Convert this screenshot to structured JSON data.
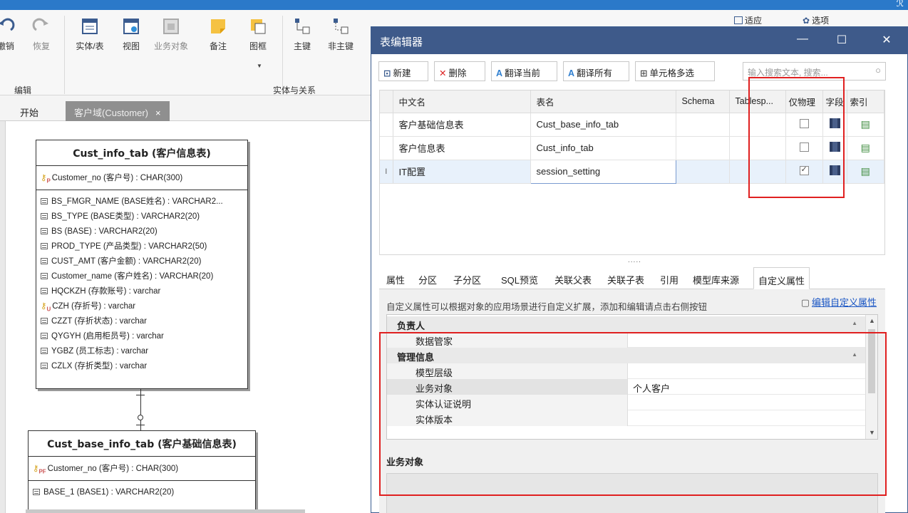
{
  "app": {
    "user_icon": "user-icon"
  },
  "ribbon": {
    "undo": "撤销",
    "redo": "恢复",
    "entity_table": "实体/表",
    "view": "视图",
    "business_object": "业务对象",
    "note": "备注",
    "frame": "图框",
    "primary_key": "主键",
    "non_primary_key": "非主键",
    "fit": "适应",
    "options": "选项",
    "group_edit": "编辑",
    "group_entity_relation": "实体与关系"
  },
  "doc_tabs": {
    "start": "开始",
    "customer": "客户域(Customer)",
    "close": "×"
  },
  "entities": {
    "cust_info": {
      "title": "Cust_info_tab (客户信息表)",
      "pk_mark": "P",
      "pk": "Customer_no (客户号) : CHAR(300)",
      "columns": [
        "BS_FMGR_NAME (BASE姓名) : VARCHAR2...",
        "BS_TYPE (BASE类型) : VARCHAR2(20)",
        "BS (BASE) : VARCHAR2(20)",
        "PROD_TYPE (产品类型) : VARCHAR2(50)",
        "CUST_AMT (客户金额) : VARCHAR2(20)",
        "Customer_name (客户姓名) : VARCHAR(20)",
        "HQCKZH (存款账号) : varchar",
        "CZH (存折号) : varchar",
        "CZZT (存折状态) : varchar",
        "QYGYH (启用柜员号) : varchar",
        "YGBZ (员工标志) : varchar",
        "CZLX (存折类型) : varchar"
      ],
      "unique_mark": "U"
    },
    "cust_base": {
      "title": "Cust_base_info_tab (客户基础信息表)",
      "pk_mark": "PF",
      "pk": "Customer_no (客户号) : CHAR(300)",
      "columns": [
        "BASE_1 (BASE1) : VARCHAR2(20)"
      ]
    }
  },
  "dialog": {
    "title": "表编辑器",
    "minimize": "—",
    "maximize": "☐",
    "close": "✕",
    "toolbar": {
      "new": "新建",
      "delete": "删除",
      "translate_current": "翻译当前",
      "translate_all": "翻译所有",
      "multi_select": "单元格多选"
    },
    "search_placeholder": "输入搜索文本, 搜索...",
    "grid": {
      "headers": [
        "中文名",
        "表名",
        "Schema",
        "Tablesp...",
        "仅物理",
        "字段",
        "索引"
      ],
      "rows": [
        {
          "cn": "客户基础信息表",
          "name": "Cust_base_info_tab",
          "physical_only": false
        },
        {
          "cn": "客户信息表",
          "name": "Cust_info_tab",
          "physical_only": false
        },
        {
          "cn": "IT配置",
          "name": "session_setting",
          "physical_only": true,
          "marker": "I"
        }
      ]
    },
    "splitter": ".....",
    "prop_tabs": [
      "属性",
      "分区",
      "子分区",
      "SQL预览",
      "关联父表",
      "关联子表",
      "引用",
      "模型库来源",
      "自定义属性"
    ],
    "custom": {
      "description": "自定义属性可以根据对象的应用场景进行自定义扩展，添加和编辑请点击右侧按钮",
      "edit_link": "编辑自定义属性",
      "cat_owner": "负责人",
      "owner_items": [
        {
          "k": "数据管家",
          "v": ""
        }
      ],
      "cat_mgmt": "管理信息",
      "mgmt_items": [
        {
          "k": "模型层级",
          "v": ""
        },
        {
          "k": "业务对象",
          "v": "个人客户"
        },
        {
          "k": "实体认证说明",
          "v": ""
        },
        {
          "k": "实体版本",
          "v": ""
        }
      ],
      "detail_title": "业务对象"
    }
  },
  "colors": {
    "accent": "#3e5a8a",
    "highlight": "#e02020",
    "titlebar": "#2b79c9"
  }
}
